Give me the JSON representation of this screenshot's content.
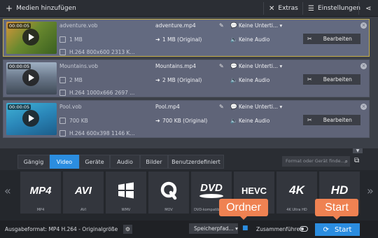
{
  "colors": {
    "accent": "#2b8de0",
    "callout": "#ef8252",
    "selected_border": "#c7b04a"
  },
  "toolbar": {
    "add_media_label": "Medien hinzufügen",
    "extras_label": "Extras",
    "settings_label": "Einstellungen"
  },
  "files": [
    {
      "duration": "00:00:05",
      "source_name": "adventure.vob",
      "source_size": "1 MB",
      "source_info": "H.264 800x600 2313 K...",
      "output_name": "adventure.mp4",
      "output_size": "1 MB (Original)",
      "subtitles": "Keine Unterti...",
      "audio": "Keine Audio",
      "edit_label": "Bearbeiten"
    },
    {
      "duration": "00:00:05",
      "source_name": "Mountains.vob",
      "source_size": "2 MB",
      "source_info": "H.264 1000x666 2697 ...",
      "output_name": "Mountains.mp4",
      "output_size": "2 MB (Original)",
      "subtitles": "Keine Unterti...",
      "audio": "Keine Audio",
      "edit_label": "Bearbeiten"
    },
    {
      "duration": "00:00:05",
      "source_name": "Pool.vob",
      "source_size": "700 KB",
      "source_info": "H.264 600x398 1146 K...",
      "output_name": "Pool.mp4",
      "output_size": "700 KB (Original)",
      "subtitles": "Keine Unterti...",
      "audio": "Keine Audio",
      "edit_label": "Bearbeiten"
    }
  ],
  "tabs": [
    "Gängig",
    "Video",
    "Geräte",
    "Audio",
    "Bilder",
    "Benutzerdefiniert"
  ],
  "active_tab": "Video",
  "search_placeholder": "Format oder Gerät finde...",
  "formats": [
    {
      "logo": "MP4",
      "label": "MP4"
    },
    {
      "logo": "AVI",
      "label": "AVI"
    },
    {
      "logo": "windows-logo",
      "label": "WMV"
    },
    {
      "logo": "quicktime-logo",
      "label": "MOV"
    },
    {
      "logo": "DVD",
      "label": "DVD-kompatibles ..."
    },
    {
      "logo": "HEVC",
      "label": "HEVC"
    },
    {
      "logo": "4K",
      "label": "4K Ultra HD"
    },
    {
      "logo": "HD",
      "label": "HD"
    }
  ],
  "bottom": {
    "output_format": "Ausgabeformat: MP4 H.264 - Originalgröße",
    "save_path_label": "Speicherpfad...",
    "merge_label": "Zusammenführen",
    "start_label": "Start"
  },
  "callouts": {
    "folder": "Ordner",
    "start": "Start"
  }
}
